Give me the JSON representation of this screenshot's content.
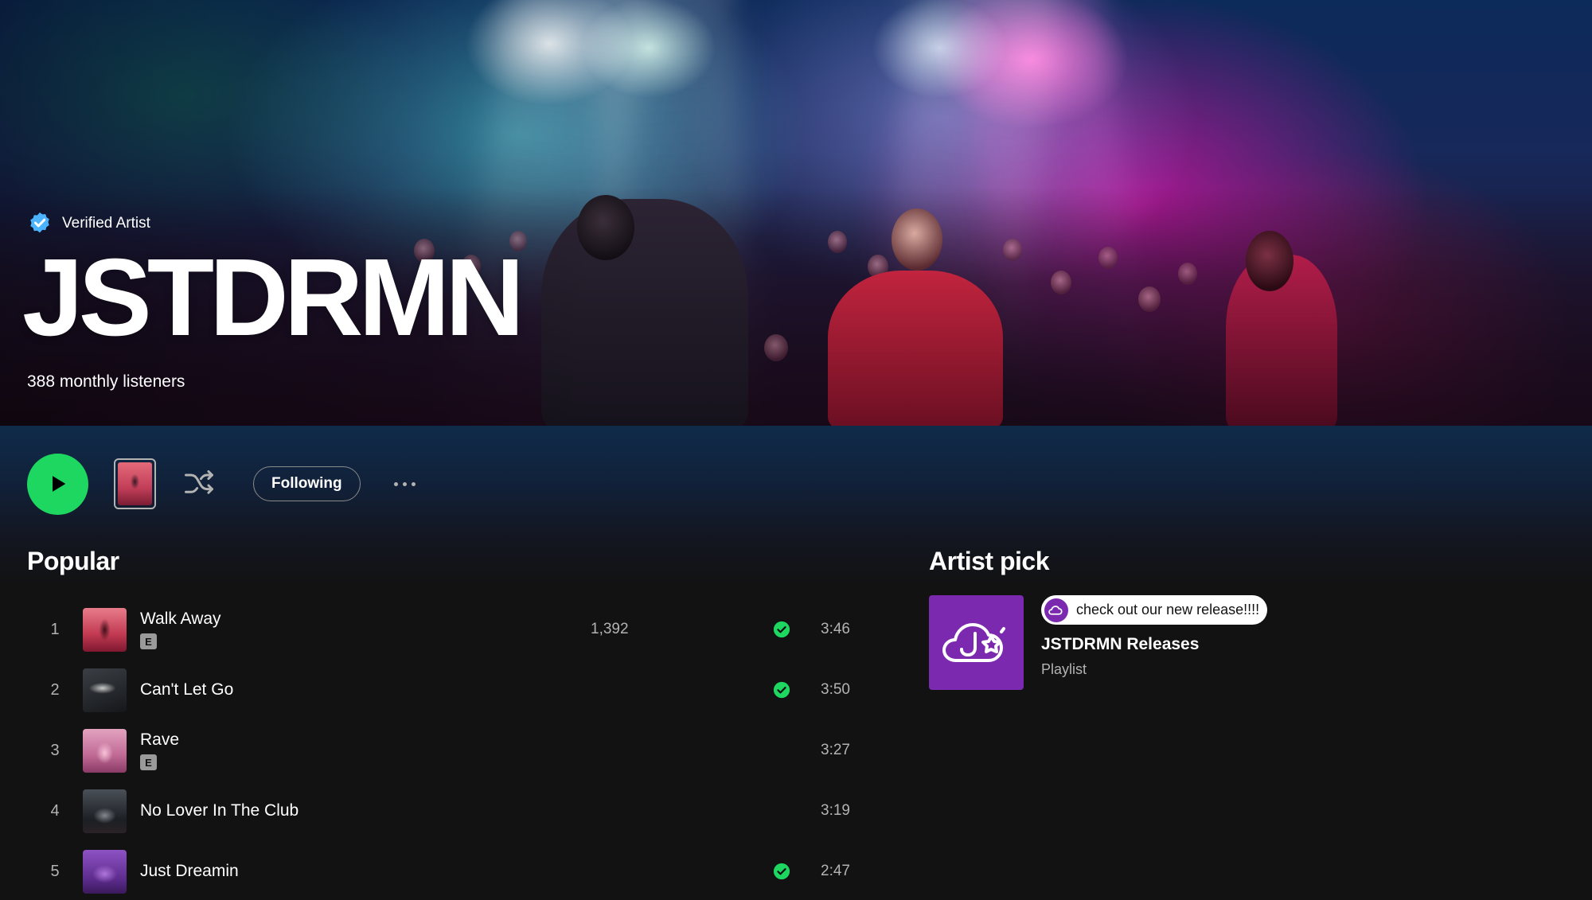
{
  "artist": {
    "verified_label": "Verified Artist",
    "name": "JSTDRMN",
    "monthly_listeners": "388 monthly listeners"
  },
  "actions": {
    "following_label": "Following"
  },
  "popular": {
    "title": "Popular",
    "tracks": [
      {
        "number": "1",
        "title": "Walk Away",
        "explicit": true,
        "explicit_label": "E",
        "plays": "1,392",
        "saved": true,
        "duration": "3:46"
      },
      {
        "number": "2",
        "title": "Can't Let Go",
        "explicit": false,
        "plays": "",
        "saved": true,
        "duration": "3:50"
      },
      {
        "number": "3",
        "title": "Rave",
        "explicit": true,
        "explicit_label": "E",
        "plays": "",
        "saved": false,
        "duration": "3:27"
      },
      {
        "number": "4",
        "title": "No Lover In The Club",
        "explicit": false,
        "plays": "",
        "saved": false,
        "duration": "3:19"
      },
      {
        "number": "5",
        "title": "Just Dreamin",
        "explicit": false,
        "plays": "",
        "saved": true,
        "duration": "2:47"
      }
    ]
  },
  "artist_pick": {
    "title": "Artist pick",
    "comment": "check out our new release!!!!",
    "playlist_name": "JSTDRMN Releases",
    "playlist_type": "Playlist"
  },
  "colors": {
    "accent_green": "#1ed760",
    "background": "#121212",
    "pick_purple": "#7b2ab0",
    "verified_blue": "#4cb3ff"
  }
}
